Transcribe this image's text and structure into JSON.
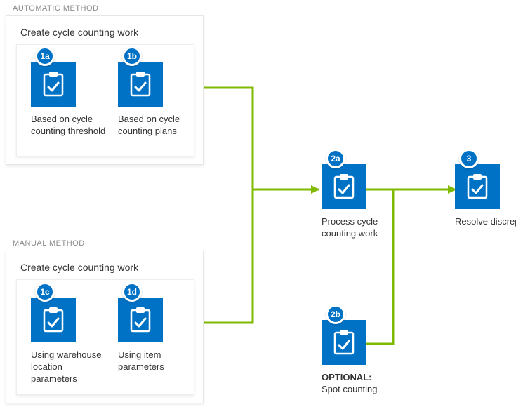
{
  "panels": {
    "automatic": {
      "label": "AUTOMATIC METHOD",
      "subtitle": "Create cycle counting work"
    },
    "manual": {
      "label": "MANUAL METHOD",
      "subtitle": "Create cycle counting work"
    }
  },
  "nodes": {
    "n1a": {
      "badge": "1a",
      "label": "Based on cycle counting threshold"
    },
    "n1b": {
      "badge": "1b",
      "label": "Based on cycle counting plans"
    },
    "n1c": {
      "badge": "1c",
      "label": "Using warehouse location parameters"
    },
    "n1d": {
      "badge": "1d",
      "label": "Using item parameters"
    },
    "n2a": {
      "badge": "2a",
      "label": "Process cycle counting work"
    },
    "n2b": {
      "badge": "2b",
      "label_prefix": "OPTIONAL:",
      "label": "Spot counting"
    },
    "n3": {
      "badge": "3",
      "label": "Resolve discrepancy"
    }
  }
}
